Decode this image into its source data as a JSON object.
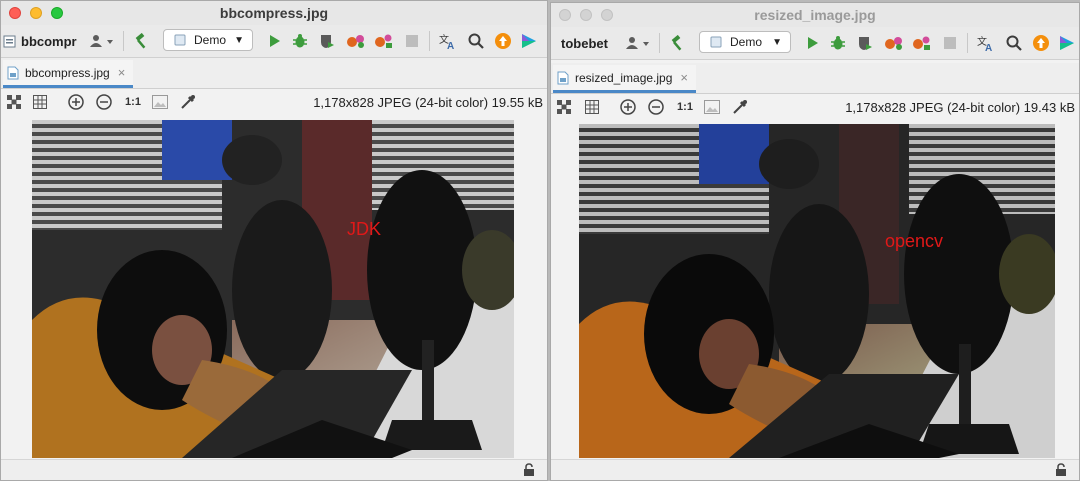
{
  "left": {
    "title": "bbcompress.jpg",
    "project": "bbcompr",
    "run_config": "Demo",
    "tab_label": "bbcompress.jpg",
    "tab_close": "×",
    "image_info": "1,178x828 JPEG (24-bit color) 19.55 kB",
    "actual_size_label": "1:1",
    "overlay_text": "JDK"
  },
  "right": {
    "title": "resized_image.jpg",
    "project": "tobebet",
    "run_config": "Demo",
    "tab_label": "resized_image.jpg",
    "tab_close": "×",
    "image_info": "1,178x828 JPEG (24-bit color) 19.43 kB",
    "actual_size_label": "1:1",
    "overlay_text": "opencv"
  },
  "icons": {
    "project": "folder-icon",
    "vcs": "user-icon",
    "build": "hammer-icon",
    "config": "java-file-icon",
    "run": "run-icon",
    "debug": "bug-icon",
    "coverage": "shield-icon",
    "profile": "profiler-icon",
    "attach": "attach-icon",
    "stop": "stop-icon",
    "translate": "translate-icon",
    "search": "search-icon",
    "update": "update-icon",
    "toolbox": "toolbox-icon"
  },
  "colors": {
    "run": "#3d9c3d",
    "debug": "#3d9c3d",
    "profile": "#e0661f",
    "update": "#f48f0c",
    "tab_underline": "#4a88c7",
    "overlay": "#e01818",
    "sweater": "#b0721f"
  }
}
